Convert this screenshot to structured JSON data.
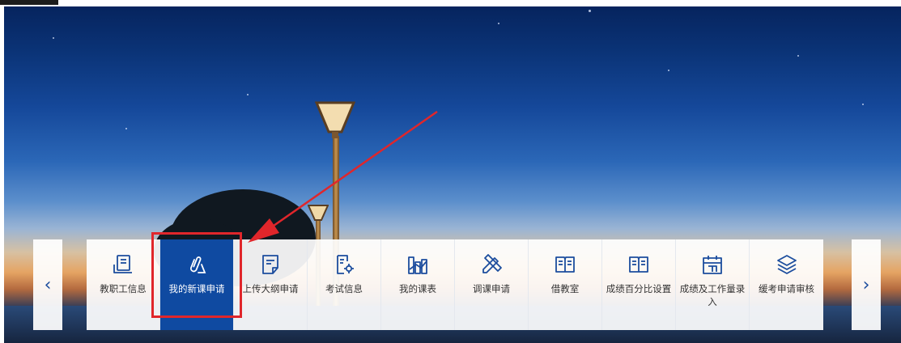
{
  "carousel": {
    "prev_arrow": "‹",
    "next_arrow": "›",
    "items": [
      {
        "label": "教职工信息",
        "icon": "profile-list-icon",
        "active": false
      },
      {
        "label": "我的新课申请",
        "icon": "paperclip-icon",
        "active": true
      },
      {
        "label": "上传大纲申请",
        "icon": "document-edit-icon",
        "active": false
      },
      {
        "label": "考试信息",
        "icon": "document-settings-icon",
        "active": false
      },
      {
        "label": "我的课表",
        "icon": "bar-chart-icon",
        "active": false
      },
      {
        "label": "调课申请",
        "icon": "pencil-ruler-icon",
        "active": false
      },
      {
        "label": "借教室",
        "icon": "open-book-icon",
        "active": false
      },
      {
        "label": "成绩百分比设置",
        "icon": "open-book-icon",
        "active": false
      },
      {
        "label": "成绩及工作量录入",
        "icon": "calendar-icon",
        "active": false
      },
      {
        "label": "缓考申请审核",
        "icon": "layers-icon",
        "active": false
      }
    ]
  },
  "colors": {
    "active_tile": "#0f4aa1",
    "icon_blue": "#1c4d9e",
    "annotation_red": "#e0262b"
  }
}
